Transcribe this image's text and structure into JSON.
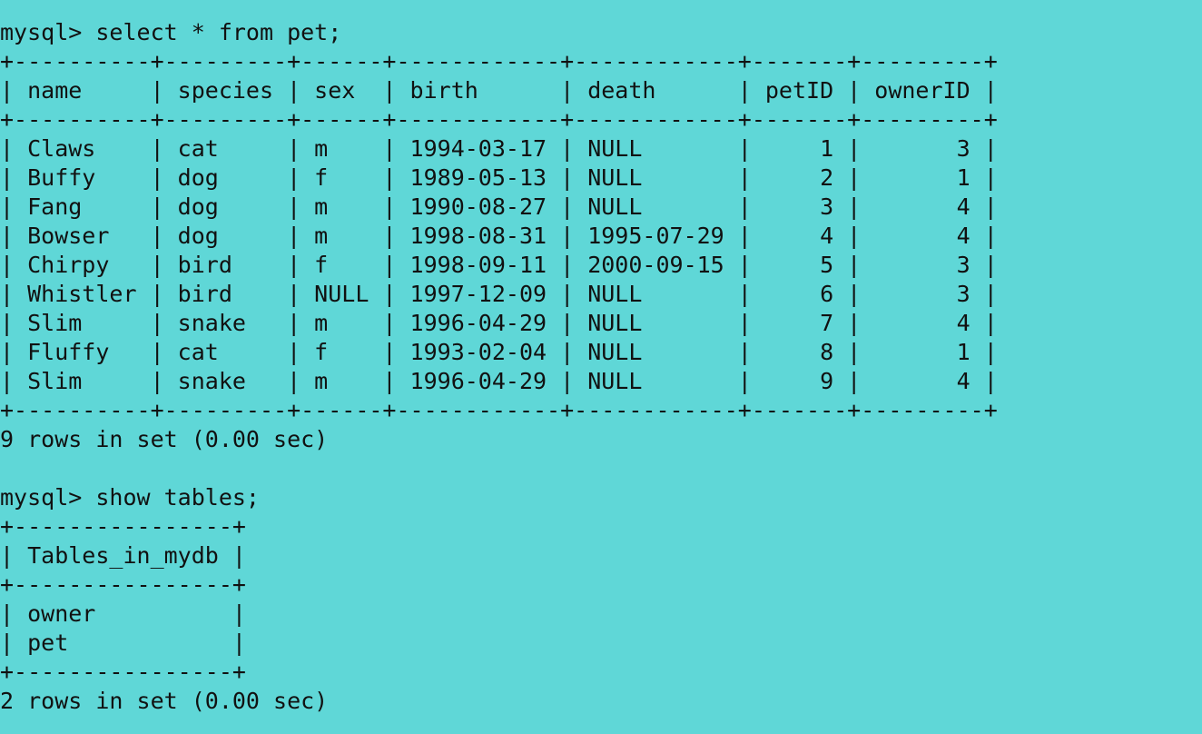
{
  "terminal": {
    "lines": [
      "mysql> select * from pet;",
      "+----------+---------+------+------------+------------+-------+---------+",
      "| name     | species | sex  | birth      | death      | petID | ownerID |",
      "+----------+---------+------+------------+------------+-------+---------+",
      "| Claws    | cat     | m    | 1994-03-17 | NULL       |     1 |       3 |",
      "| Buffy    | dog     | f    | 1989-05-13 | NULL       |     2 |       1 |",
      "| Fang     | dog     | m    | 1990-08-27 | NULL       |     3 |       4 |",
      "| Bowser   | dog     | m    | 1998-08-31 | 1995-07-29 |     4 |       4 |",
      "| Chirpy   | bird    | f    | 1998-09-11 | 2000-09-15 |     5 |       3 |",
      "| Whistler | bird    | NULL | 1997-12-09 | NULL       |     6 |       3 |",
      "| Slim     | snake   | m    | 1996-04-29 | NULL       |     7 |       4 |",
      "| Fluffy   | cat     | f    | 1993-02-04 | NULL       |     8 |       1 |",
      "| Slim     | snake   | m    | 1996-04-29 | NULL       |     9 |       4 |",
      "+----------+---------+------+------------+------------+-------+---------+",
      "9 rows in set (0.00 sec)",
      "",
      "mysql> show tables;",
      "+----------------+",
      "| Tables_in_mydb |",
      "+----------------+",
      "| owner          |",
      "| pet            |",
      "+----------------+",
      "2 rows in set (0.00 sec)"
    ]
  },
  "colors": {
    "background": "#5fd7d7",
    "text": "#111111"
  }
}
